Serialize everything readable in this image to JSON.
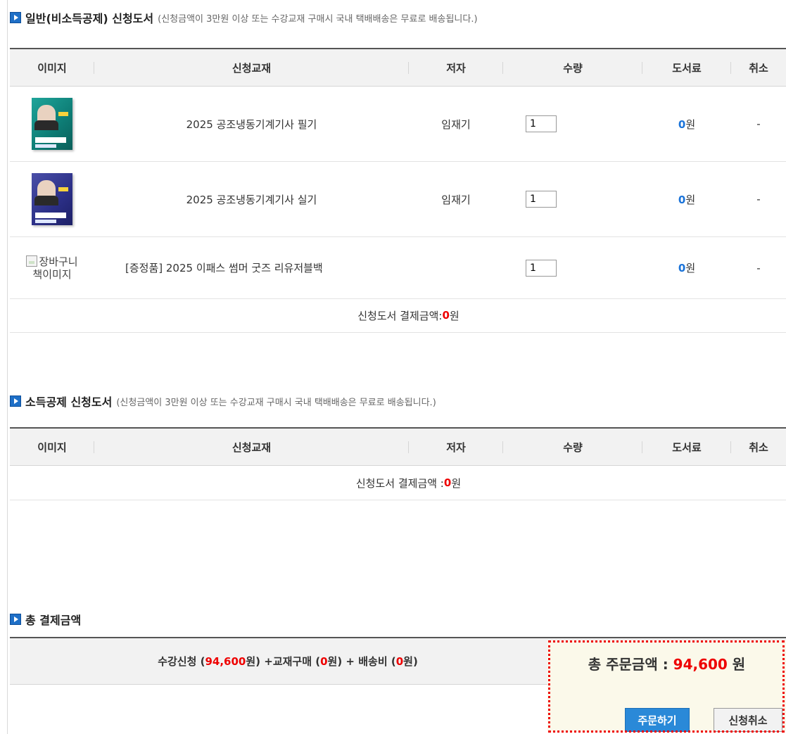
{
  "section1": {
    "title": "일반(비소득공제) 신청도서",
    "note": "(신청금액이 3만원 이상 또는 수강교재 구매시 국내 택배배송은 무료로 배송됩니다.)",
    "headers": [
      "이미지",
      "신청교재",
      "저자",
      "수량",
      "도서료",
      "취소"
    ],
    "rows": [
      {
        "image": "book-cover-teal",
        "title": "2025 공조냉동기계기사 필기",
        "author": "임재기",
        "qty": "1",
        "price": "0",
        "price_unit": "원",
        "cancel": "-"
      },
      {
        "image": "book-cover-navy",
        "title": "2025 공조냉동기계기사 실기",
        "author": "임재기",
        "qty": "1",
        "price": "0",
        "price_unit": "원",
        "cancel": "-"
      },
      {
        "image_alt": "장바구니 책이미지",
        "title": "[증정품] 2025 이패스 썸머 굿즈 리유저블백",
        "author": "",
        "qty": "1",
        "price": "0",
        "price_unit": "원",
        "cancel": "-"
      }
    ],
    "summary_label": "신청도서 결제금액:",
    "summary_amount": "0",
    "summary_unit": " 원"
  },
  "section2": {
    "title": "소득공제 신청도서",
    "note": "(신청금액이 3만원 이상 또는 수강교재 구매시 국내 택배배송은 무료로 배송됩니다.)",
    "headers": [
      "이미지",
      "신청교재",
      "저자",
      "수량",
      "도서료",
      "취소"
    ],
    "summary_label": "신청도서 결제금액 :",
    "summary_amount": "0",
    "summary_unit": " 원"
  },
  "total": {
    "title": "총 결제금액",
    "course_label": "수강신청 (",
    "course_amount": "94,600",
    "course_suffix": "원) +교재구매 (",
    "book_amount": "0",
    "book_suffix": "원) + 배송비 (",
    "shipping_amount": "0",
    "shipping_suffix": "원)",
    "order_label": "총 주문금액 : ",
    "order_amount": "94,600",
    "order_unit": " 원",
    "order_button": "주문하기",
    "cancel_button": "신청취소"
  },
  "colors": {
    "accent_blue": "#1e6fc7",
    "amount_red": "#ee0000",
    "price_blue": "#1a73d9",
    "highlight_frame": "#ee0000"
  }
}
